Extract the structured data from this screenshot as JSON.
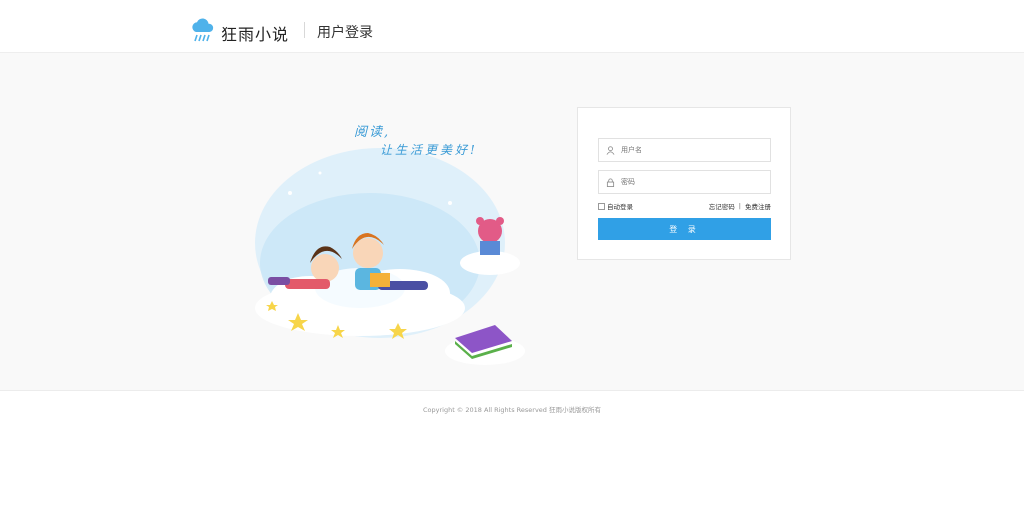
{
  "header": {
    "brand": "狂雨小说",
    "title": "用户登录",
    "logo_icon": "cloud-rain-icon",
    "brand_color": "#4fb2ea"
  },
  "illustration": {
    "line1": "阅读,",
    "line2": "让生活更美好!"
  },
  "login": {
    "username_placeholder": "用户名",
    "password_placeholder": "密码",
    "username_icon": "user-icon",
    "password_icon": "lock-icon",
    "auto_login_label": "自动登录",
    "forgot_password": "忘记密码",
    "link_separator": "|",
    "register": "免费注册",
    "submit_label": "登 录",
    "accent_color": "#30a0e6"
  },
  "footer": {
    "copyright": "Copyright © 2018 All Rights Reserved 狂雨小说版权所有"
  }
}
